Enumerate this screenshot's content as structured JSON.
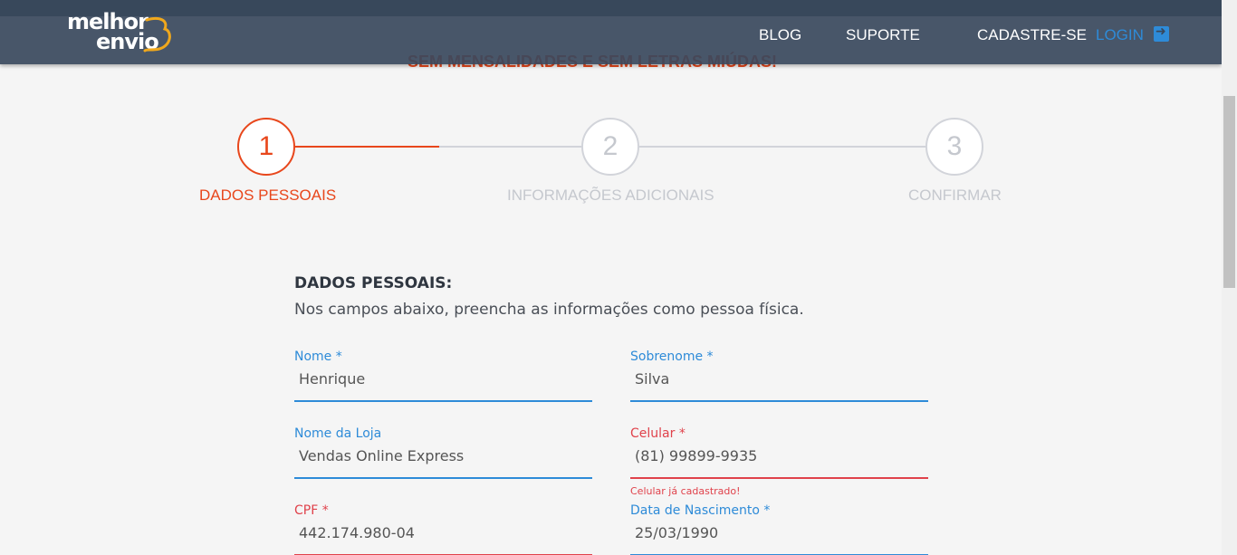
{
  "header": {
    "logo_line1": "melhor",
    "logo_line2": "envio",
    "nav": {
      "blog": "BLOG",
      "suporte": "SUPORTE",
      "cadastre": "CADASTRE-SE",
      "login": "LOGIN"
    }
  },
  "promo": "SEM MENSALIDADES E SEM LETRAS MIÚDAS!",
  "steps": [
    {
      "number": "1",
      "label": "DADOS PESSOAIS",
      "active": true
    },
    {
      "number": "2",
      "label": "INFORMAÇÕES ADICIONAIS",
      "active": false
    },
    {
      "number": "3",
      "label": "CONFIRMAR",
      "active": false
    }
  ],
  "form": {
    "title": "DADOS PESSOAIS:",
    "subtitle": "Nos campos abaixo, preencha as informações como pessoa física.",
    "fields": {
      "nome": {
        "label": "Nome *",
        "value": "Henrique"
      },
      "sobrenome": {
        "label": "Sobrenome *",
        "value": "Silva"
      },
      "loja": {
        "label": "Nome da Loja",
        "value": "Vendas Online Express"
      },
      "celular": {
        "label": "Celular *",
        "value": "(81) 99899-9935",
        "error": "Celular já cadastrado!"
      },
      "cpf": {
        "label": "CPF *",
        "value": "442.174.980-04"
      },
      "nascimento": {
        "label": "Data de Nascimento *",
        "value": "25/03/1990"
      }
    }
  },
  "colors": {
    "accent": "#e8471c",
    "link": "#2e8bd8",
    "error": "#e0424b",
    "header": "#38485c"
  }
}
